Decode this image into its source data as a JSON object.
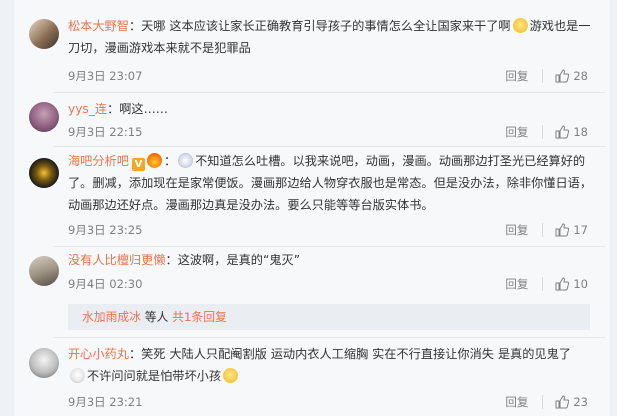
{
  "comments": [
    {
      "user": "松本大野智",
      "text_line1": "天哪 这本应该让家长正确教育引导孩子的事情怎么全让国家来干了啊",
      "text_after_emoji": "游戏也是一",
      "text_line2": "刀切，漫画游戏本来就不是犯罪品",
      "time": "9月3日 23:07",
      "reply": "回复",
      "likes": "28"
    },
    {
      "user": "yys_连",
      "text": "啊这……",
      "time": "9月3日 22:15",
      "reply": "回复",
      "likes": "18"
    },
    {
      "user": "海吧分析吧",
      "badge": "V",
      "text_line1": "不知道怎么吐槽。以我来说吧，动画，漫画。动画那边打圣光已经算好的",
      "text_line2": "了。删减，添加现在是家常便饭。漫画那边给人物穿衣服也是常态。但是没办法，除非你懂日语，",
      "text_line3": "动画那边还好点。漫画那边真是没办法。要么只能等等台版实体书。",
      "time": "9月3日 23:25",
      "reply": "回复",
      "likes": "17"
    },
    {
      "user": "没有人比檀归更懒",
      "text": "这波啊，是真的“鬼灭”",
      "time": "9月4日 02:30",
      "reply": "回复",
      "likes": "10"
    },
    {
      "user": "开心小药丸",
      "text_line1": "笑死 大陆人只配阉割版 运动内衣人工缩胸 实在不行直接让你消失 是真的见鬼了",
      "text_line2": "不许问问就是怕带坏小孩",
      "time": "9月3日 23:21",
      "reply": "回复",
      "likes": "23"
    }
  ],
  "subreply": {
    "user": "水加雨成冰",
    "middle": " 等人 ",
    "count_link": "共1条回复"
  },
  "colors": {
    "username": "#eb7350",
    "meta": "#808080",
    "panel": "#f6f8fa"
  }
}
